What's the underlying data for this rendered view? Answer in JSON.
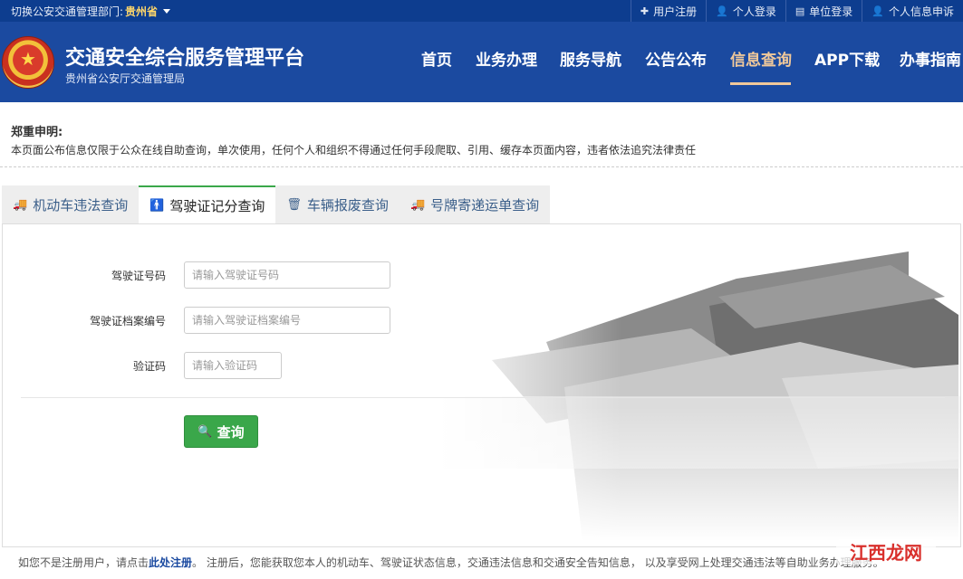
{
  "topbar": {
    "dept_label": "切换公安交通管理部门:",
    "province": "贵州省",
    "links": [
      {
        "icon": "plus-icon",
        "label": "用户注册"
      },
      {
        "icon": "user-icon",
        "label": "个人登录"
      },
      {
        "icon": "building-icon",
        "label": "单位登录"
      },
      {
        "icon": "user-icon",
        "label": "个人信息申诉"
      }
    ]
  },
  "header": {
    "title": "交通安全综合服务管理平台",
    "subtitle": "贵州省公安厅交通管理局",
    "nav": [
      {
        "label": "首页",
        "active": false
      },
      {
        "label": "业务办理",
        "active": false
      },
      {
        "label": "服务导航",
        "active": false
      },
      {
        "label": "公告公布",
        "active": false
      },
      {
        "label": "信息查询",
        "active": true
      },
      {
        "label": "APP下载",
        "active": false
      },
      {
        "label": "办事指南",
        "active": false
      }
    ]
  },
  "notice": {
    "title": "郑重申明:",
    "text": "本页面公布信息仅限于公众在线自助查询，单次使用，任何个人和组织不得通过任何手段爬取、引用、缓存本页面内容，违者依法追究法律责任"
  },
  "tabs": [
    {
      "icon": "truck-icon",
      "label": "机动车违法查询",
      "active": false
    },
    {
      "icon": "person-icon",
      "label": "驾驶证记分查询",
      "active": true
    },
    {
      "icon": "trash-icon",
      "label": "车辆报废查询",
      "active": false
    },
    {
      "icon": "truck-icon",
      "label": "号牌寄递运单查询",
      "active": false
    }
  ],
  "form": {
    "license_no": {
      "label": "驾驶证号码",
      "placeholder": "请输入驾驶证号码",
      "value": ""
    },
    "file_no": {
      "label": "驾驶证档案编号",
      "placeholder": "请输入驾驶证档案编号",
      "value": ""
    },
    "captcha": {
      "label": "验证码",
      "placeholder": "请输入验证码",
      "value": ""
    },
    "submit_label": "查询"
  },
  "footer": {
    "text_before": "如您不是注册用户，请点击",
    "register_link": "此处注册",
    "text_after": "。 注册后，您能获取您本人的机动车、驾驶证状态信息，交通违法信息和交通安全告知信息， 以及享受网上处理交通违法等自助业务办理服务。"
  },
  "watermark": "江西龙网",
  "colors": {
    "header_bg": "#1b4aa0",
    "topbar_bg": "#0d3d8f",
    "accent": "#f0c89a",
    "button": "#3aa74a"
  }
}
